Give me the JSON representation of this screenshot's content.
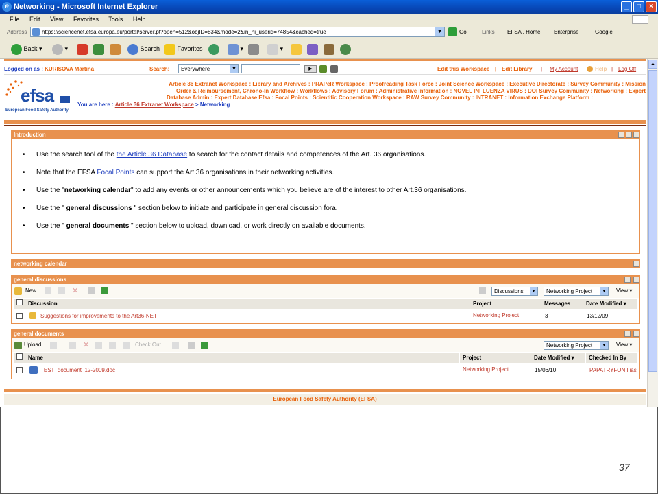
{
  "window": {
    "title": "Networking - Microsoft Internet Explorer"
  },
  "menu": [
    "File",
    "Edit",
    "View",
    "Favorites",
    "Tools",
    "Help"
  ],
  "address": {
    "label": "Address",
    "url": "https://sciencenet.efsa.europa.eu/portal/server.pt?open=512&objID=834&mode=2&in_hi_userid=74854&cached=true",
    "go": "Go",
    "links_label": "Links",
    "links": [
      "EFSA . Home",
      "Enterprise",
      "Google"
    ]
  },
  "toolbar": {
    "back": "Back",
    "search": "Search",
    "favorites": "Favorites"
  },
  "logbar": {
    "logged_label": "Logged on as :",
    "user": "KURISOVA Martina",
    "search_label": "Search:",
    "search_scope": "Everywhere",
    "search_value": "",
    "right_links": [
      "Edit this Workspace",
      "Edit Library",
      "My Account",
      "Help",
      "Log Off"
    ]
  },
  "logo": {
    "text": "efsa",
    "tagline": "European Food Safety Authority"
  },
  "nav": {
    "line1": "Article 36 Extranet Workspace : Library and Archives : PRAPeR Workspace : Proofreading Task Force : Joint Science Workspace : Executive Directorate : Survey Community : Mission",
    "line2": "Order & Reimbursement, Chrono-In Workflow : Workflows : Advisory Forum : Administrative information : NOVEL INFLUENZA VIRUS : DOI Survey Community : Networking : Expert",
    "line3": "Database Admin : Expert Database Efsa : Focal Points : Scientific Cooperation Workspace : RAW Survey Community : INTRANET : Information Exchange Platform :",
    "you_are_here": "You are here :",
    "crumb1": "Article 36 Extranet Workspace",
    "crumb_sep": " > ",
    "crumb2": "Networking"
  },
  "intro": {
    "title": "Introduction",
    "b1_pre": "Use the search tool of the ",
    "b1_link": "the Article 36 Database",
    "b1_post": " to search for the contact details and competences of the Art. 36 organisations.",
    "b2_pre": "Note that the EFSA ",
    "b2_link": "Focal Points",
    "b2_post": " can support the Art.36 organisations in their networking activities.",
    "b3_pre": "Use the \"",
    "b3_bold": "networking calendar",
    "b3_post": "\" to add any events or other announcements which you believe are of the interest to other Art.36 organisations.",
    "b4_pre": "Use the \" ",
    "b4_bold": "general discussions",
    "b4_post": " \" section below to initiate and participate in general discussion fora.",
    "b5_pre": "Use the \" ",
    "b5_bold": "general documents",
    "b5_post": " \" section below to upload, download, or work directly on available documents."
  },
  "calendar": {
    "title": "networking calendar"
  },
  "discussions": {
    "title": "general discussions",
    "new_label": "New",
    "filter1": "Discussions",
    "filter2": "Networking Project",
    "view": "View",
    "headers": [
      "Discussion",
      "Project",
      "Messages",
      "Date Modified"
    ],
    "rows": [
      {
        "name": "Suggestions for improvements to the Art36-NET",
        "project": "Networking Project",
        "messages": "3",
        "date": "13/12/09"
      }
    ]
  },
  "documents": {
    "title": "general documents",
    "upload_label": "Upload",
    "checkout_label": "Check Out",
    "filter": "Networking Project",
    "view": "View",
    "headers": [
      "Name",
      "Project",
      "Date Modified",
      "Checked In By"
    ],
    "rows": [
      {
        "name": "TEST_document_12-2009.doc",
        "project": "Networking Project",
        "date": "15/06/10",
        "by": "PAPATRYFON Ilias"
      }
    ]
  },
  "footer": {
    "text": "European Food Safety Authority (EFSA)"
  },
  "slide_number": "37",
  "colors": {
    "accent": "#e8610a",
    "panel": "#e8914e",
    "link": "#1f3fbf"
  }
}
